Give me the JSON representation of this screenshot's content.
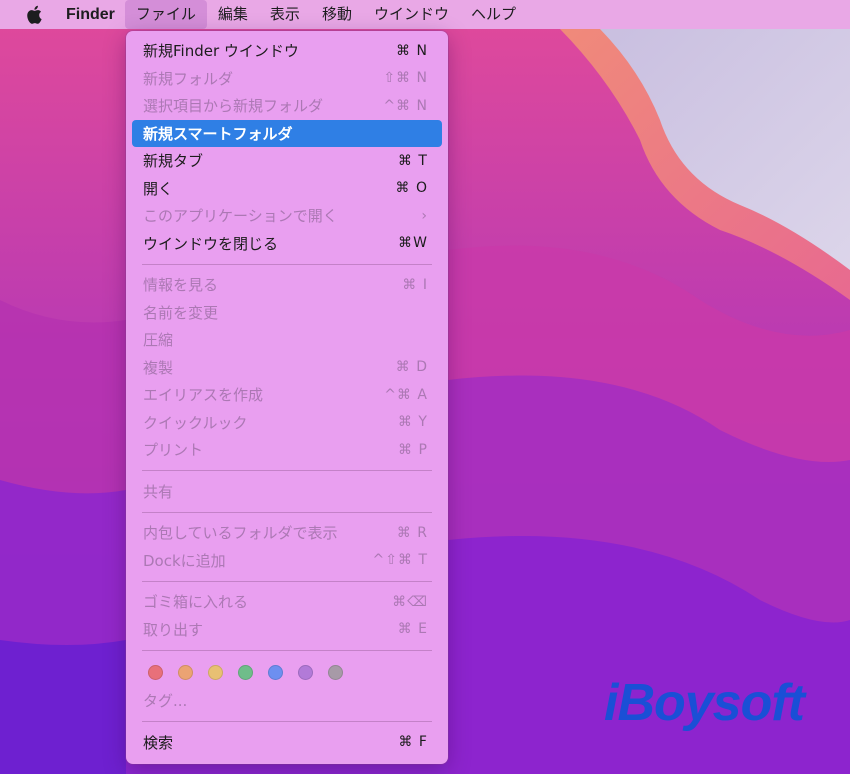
{
  "menubar": {
    "app_name": "Finder",
    "items": [
      "ファイル",
      "編集",
      "表示",
      "移動",
      "ウインドウ",
      "ヘルプ"
    ]
  },
  "menu": {
    "groups": [
      [
        {
          "label": "新規Finder ウインドウ",
          "shortcut": "⌘ N",
          "state": "enabled"
        },
        {
          "label": "新規フォルダ",
          "shortcut": "⇧⌘ N",
          "state": "disabled"
        },
        {
          "label": "選択項目から新規フォルダ",
          "shortcut": "^⌘ N",
          "state": "disabled"
        },
        {
          "label": "新規スマートフォルダ",
          "shortcut": "",
          "state": "highlighted"
        },
        {
          "label": "新規タブ",
          "shortcut": "⌘ T",
          "state": "enabled"
        },
        {
          "label": "開く",
          "shortcut": "⌘ O",
          "state": "enabled"
        },
        {
          "label": "このアプリケーションで開く",
          "shortcut": "›",
          "state": "disabled"
        },
        {
          "label": "ウインドウを閉じる",
          "shortcut": "⌘W",
          "state": "enabled"
        }
      ],
      [
        {
          "label": "情報を見る",
          "shortcut": "⌘ I",
          "state": "disabled"
        },
        {
          "label": "名前を変更",
          "shortcut": "",
          "state": "disabled"
        },
        {
          "label": "圧縮",
          "shortcut": "",
          "state": "disabled"
        },
        {
          "label": "複製",
          "shortcut": "⌘ D",
          "state": "disabled"
        },
        {
          "label": "エイリアスを作成",
          "shortcut": "^⌘ A",
          "state": "disabled"
        },
        {
          "label": "クイックルック",
          "shortcut": "⌘ Y",
          "state": "disabled"
        },
        {
          "label": "プリント",
          "shortcut": "⌘ P",
          "state": "disabled"
        }
      ],
      [
        {
          "label": "共有",
          "shortcut": "",
          "state": "disabled"
        }
      ],
      [
        {
          "label": "内包しているフォルダで表示",
          "shortcut": "⌘ R",
          "state": "disabled"
        },
        {
          "label": "Dockに追加",
          "shortcut": "^⇧⌘ T",
          "state": "disabled"
        }
      ],
      [
        {
          "label": "ゴミ箱に入れる",
          "shortcut": "⌘⌫",
          "state": "disabled"
        },
        {
          "label": "取り出す",
          "shortcut": "⌘ E",
          "state": "disabled"
        }
      ]
    ],
    "tag_colors": [
      "#e8707a",
      "#eba373",
      "#e8c073",
      "#6fbd8a",
      "#6d8ff0",
      "#b27ad8",
      "#a79aa7"
    ],
    "tags_label": "タグ...",
    "search": {
      "label": "検索",
      "shortcut": "⌘ F"
    }
  },
  "watermark": {
    "brand": "iBoysoft",
    "color": "#1a4fd6"
  }
}
